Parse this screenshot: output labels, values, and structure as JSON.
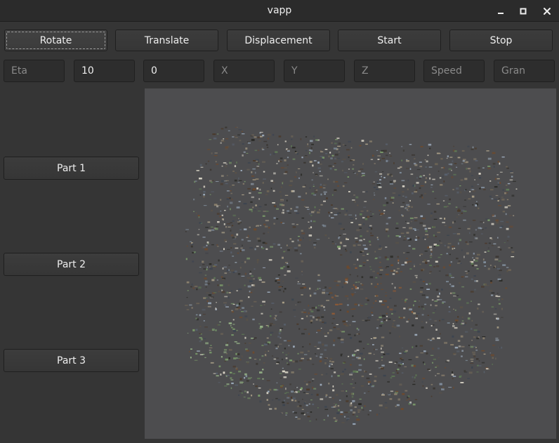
{
  "window": {
    "title": "vapp",
    "controls": {
      "minimize": "minimize-icon",
      "maximize": "maximize-icon",
      "close": "close-icon"
    }
  },
  "toolbar": {
    "buttons": [
      {
        "label": "Rotate",
        "focused": true
      },
      {
        "label": "Translate"
      },
      {
        "label": "Displacement"
      },
      {
        "label": "Start"
      },
      {
        "label": "Stop"
      }
    ]
  },
  "params": [
    {
      "placeholder": "Eta",
      "value": ""
    },
    {
      "placeholder": "",
      "value": "10"
    },
    {
      "placeholder": "",
      "value": "0"
    },
    {
      "placeholder": "X",
      "value": ""
    },
    {
      "placeholder": "Y",
      "value": ""
    },
    {
      "placeholder": "Z",
      "value": ""
    },
    {
      "placeholder": "Speed",
      "value": ""
    },
    {
      "placeholder": "Gran",
      "value": ""
    }
  ],
  "parts": [
    {
      "label": "Part 1"
    },
    {
      "label": "Part 2"
    },
    {
      "label": "Part 3"
    }
  ],
  "colors": {
    "window_bg": "#353535",
    "titlebar_bg": "#2b2b2b",
    "viewport_bg": "#4d4d4f",
    "text": "#eeeeee",
    "placeholder": "#8a8a8a"
  }
}
